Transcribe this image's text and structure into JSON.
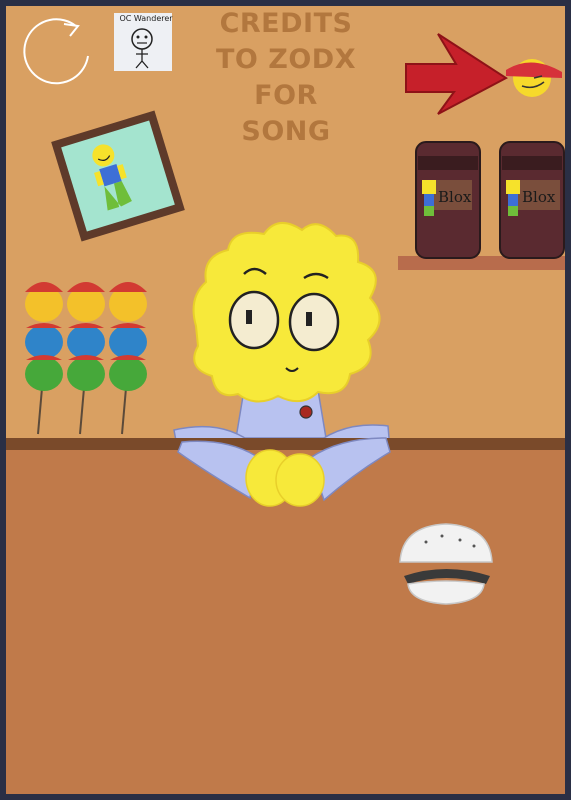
{
  "credits": {
    "line1": "CREDITS",
    "line2": "TO ZODX",
    "line3": "FOR",
    "line4": "SONG"
  },
  "oc_card": {
    "label": "OC Wanderer"
  },
  "can_left": {
    "brand": "Blox"
  },
  "can_right": {
    "brand": "Blox"
  },
  "icons": {
    "restart": "restart-icon",
    "arrow": "red-arrow-icon",
    "sunglasses_face": "emoji-face-icon"
  },
  "colors": {
    "wall": "#d9a062",
    "counter_top": "#7a4a2a",
    "counter": "#c07a4a",
    "frame": "#2a2f45",
    "credits_text": "#b2773e",
    "character_hair": "#f7e93a",
    "shirt": "#b8c2f0"
  }
}
